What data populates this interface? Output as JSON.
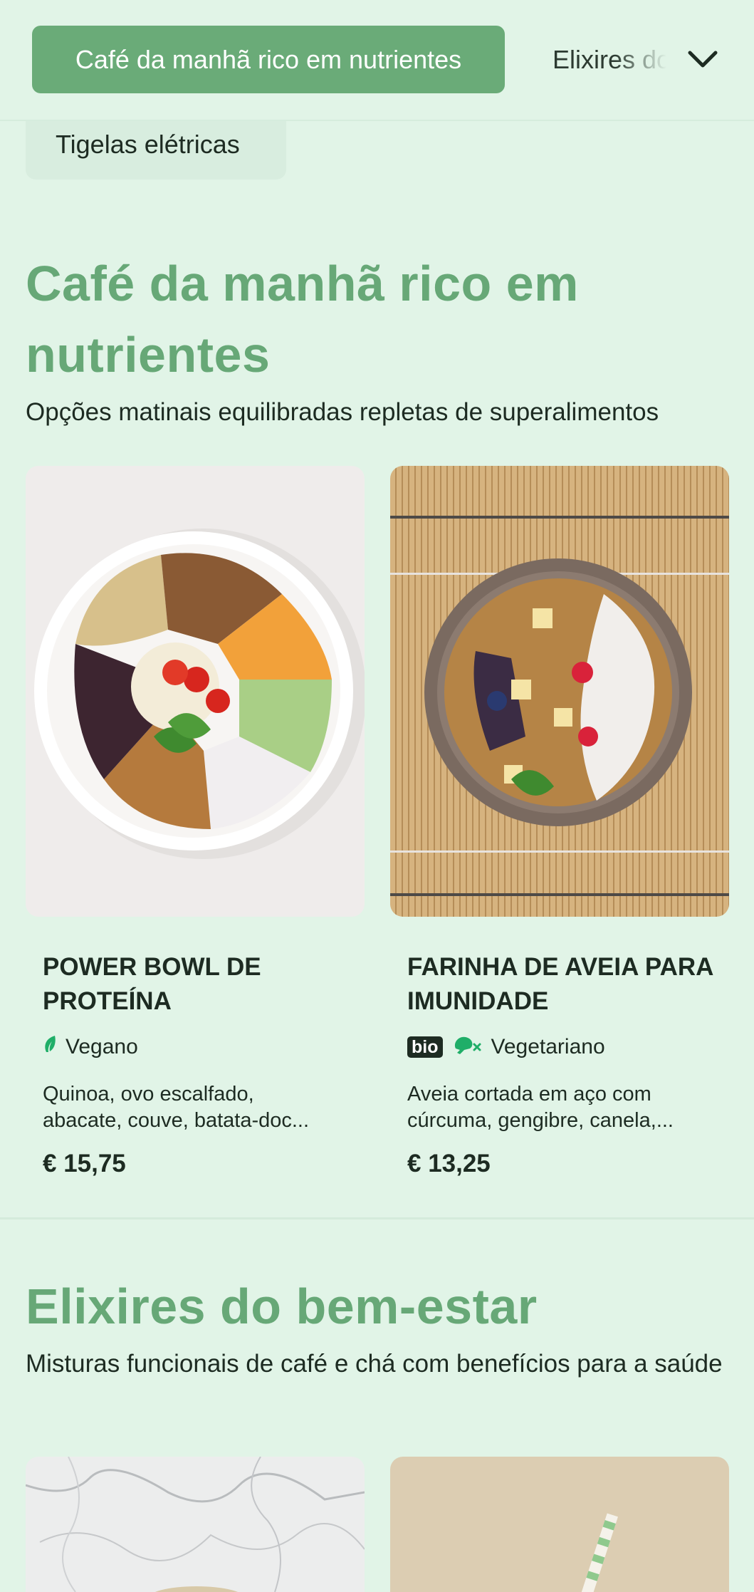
{
  "nav": {
    "active_category": "Café da manhã rico em nutrientes",
    "next_category": "Elixires do bem-estar",
    "below_category": "Tigelas elétricas"
  },
  "sections": [
    {
      "title": "Café da manhã rico em nutrientes",
      "subtitle": "Opções matinais equilibradas repletas de superalimentos",
      "items": [
        {
          "name": "POWER BOWL DE PROTEÍNA",
          "tags": [
            "Vegano"
          ],
          "tag_icon": "leaf-icon",
          "description": "Quinoa, ovo escalfado, abacate, couve, batata-doce…",
          "desc_line1": "Quinoa, ovo escalfado,",
          "desc_line2": "abacate, couve, batata-doc...",
          "price": "€ 15,75"
        },
        {
          "name": "FARINHA DE AVEIA PARA IMUNIDADE",
          "badge": "bio",
          "tags": [
            "Vegetariano"
          ],
          "tag_icon": "no-meat-icon",
          "desc_line1": "Aveia cortada em aço com",
          "desc_line2": "cúrcuma, gengibre, canela,...",
          "price": "€ 13,25"
        }
      ]
    },
    {
      "title": "Elixires do bem-estar",
      "subtitle": "Misturas funcionais de café e chá com benefícios para a saúde"
    }
  ],
  "colors": {
    "background": "#e1f4e7",
    "accent": "#6aab78",
    "heading": "#67a877",
    "text": "#1d2b22",
    "tag_green": "#1fae68"
  }
}
